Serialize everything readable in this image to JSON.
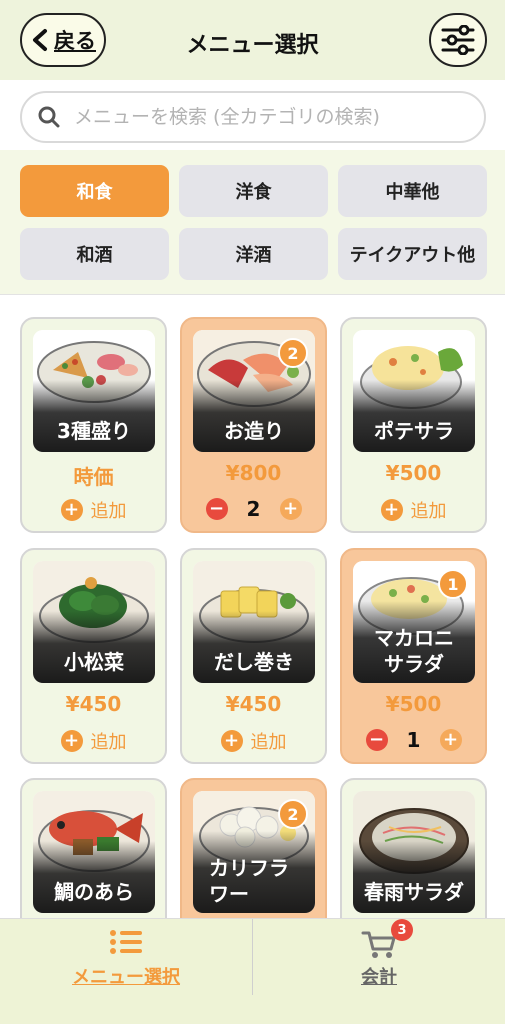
{
  "header": {
    "back_label": "戻る",
    "title": "メニュー選択"
  },
  "search": {
    "placeholder": "メニューを検索 (全カテゴリの検索)"
  },
  "categories": [
    {
      "label": "和食",
      "active": true
    },
    {
      "label": "洋食",
      "active": false
    },
    {
      "label": "中華他",
      "active": false
    },
    {
      "label": "和酒",
      "active": false
    },
    {
      "label": "洋酒",
      "active": false
    },
    {
      "label": "テイクアウト他",
      "active": false
    }
  ],
  "menu_items": [
    {
      "name": "3種盛り",
      "price": "時価",
      "add_label": "追加",
      "selected": false
    },
    {
      "name": "お造り",
      "price": "¥800",
      "quantity": "2",
      "badge": "2",
      "selected": true
    },
    {
      "name": "ポテサラ",
      "price": "¥500",
      "add_label": "追加",
      "selected": false
    },
    {
      "name": "小松菜",
      "price": "¥450",
      "add_label": "追加",
      "selected": false
    },
    {
      "name": "だし巻き",
      "price": "¥450",
      "add_label": "追加",
      "selected": false
    },
    {
      "name": "マカロニ\nサラダ",
      "price": "¥500",
      "quantity": "1",
      "badge": "1",
      "selected": true
    },
    {
      "name": "鯛のあら",
      "selected": false
    },
    {
      "name": "カリフラ\nワー",
      "badge": "2",
      "selected": true
    },
    {
      "name": "春雨サラダ",
      "selected": false
    }
  ],
  "bottom_nav": {
    "menu_label": "メニュー選択",
    "checkout_label": "会計",
    "cart_count": "3"
  },
  "colors": {
    "accent": "#f39a3c",
    "selected_card": "#f8c79b",
    "minus": "#e84a3d",
    "header_bg": "#eef3dc"
  }
}
